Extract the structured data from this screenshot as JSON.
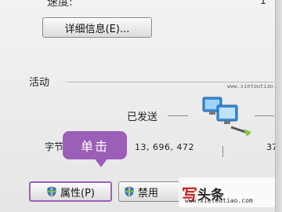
{
  "status": {
    "speed_label": "速度:",
    "speed_value": "1"
  },
  "details_button": {
    "label": "详细信息(E)..."
  },
  "activity": {
    "section_label": "活动",
    "sent_label": "已发送",
    "bytes_label": "字节",
    "bytes_sent": "13, 696, 472",
    "bytes_received": "37"
  },
  "tooltip": {
    "text": "单击"
  },
  "buttons": {
    "properties_label": "属性(P)",
    "disable_label": "禁用"
  },
  "watermark": {
    "logo": "写",
    "text": "头条",
    "url": "www.xietoutiao.com"
  },
  "top_url": "www.xietoutiao.com",
  "colors": {
    "tooltip": "#9c5fb8",
    "watermark_logo": "#c81e1e"
  },
  "icons": {
    "network": "network-computers-icon",
    "shield": "uac-shield-icon"
  }
}
